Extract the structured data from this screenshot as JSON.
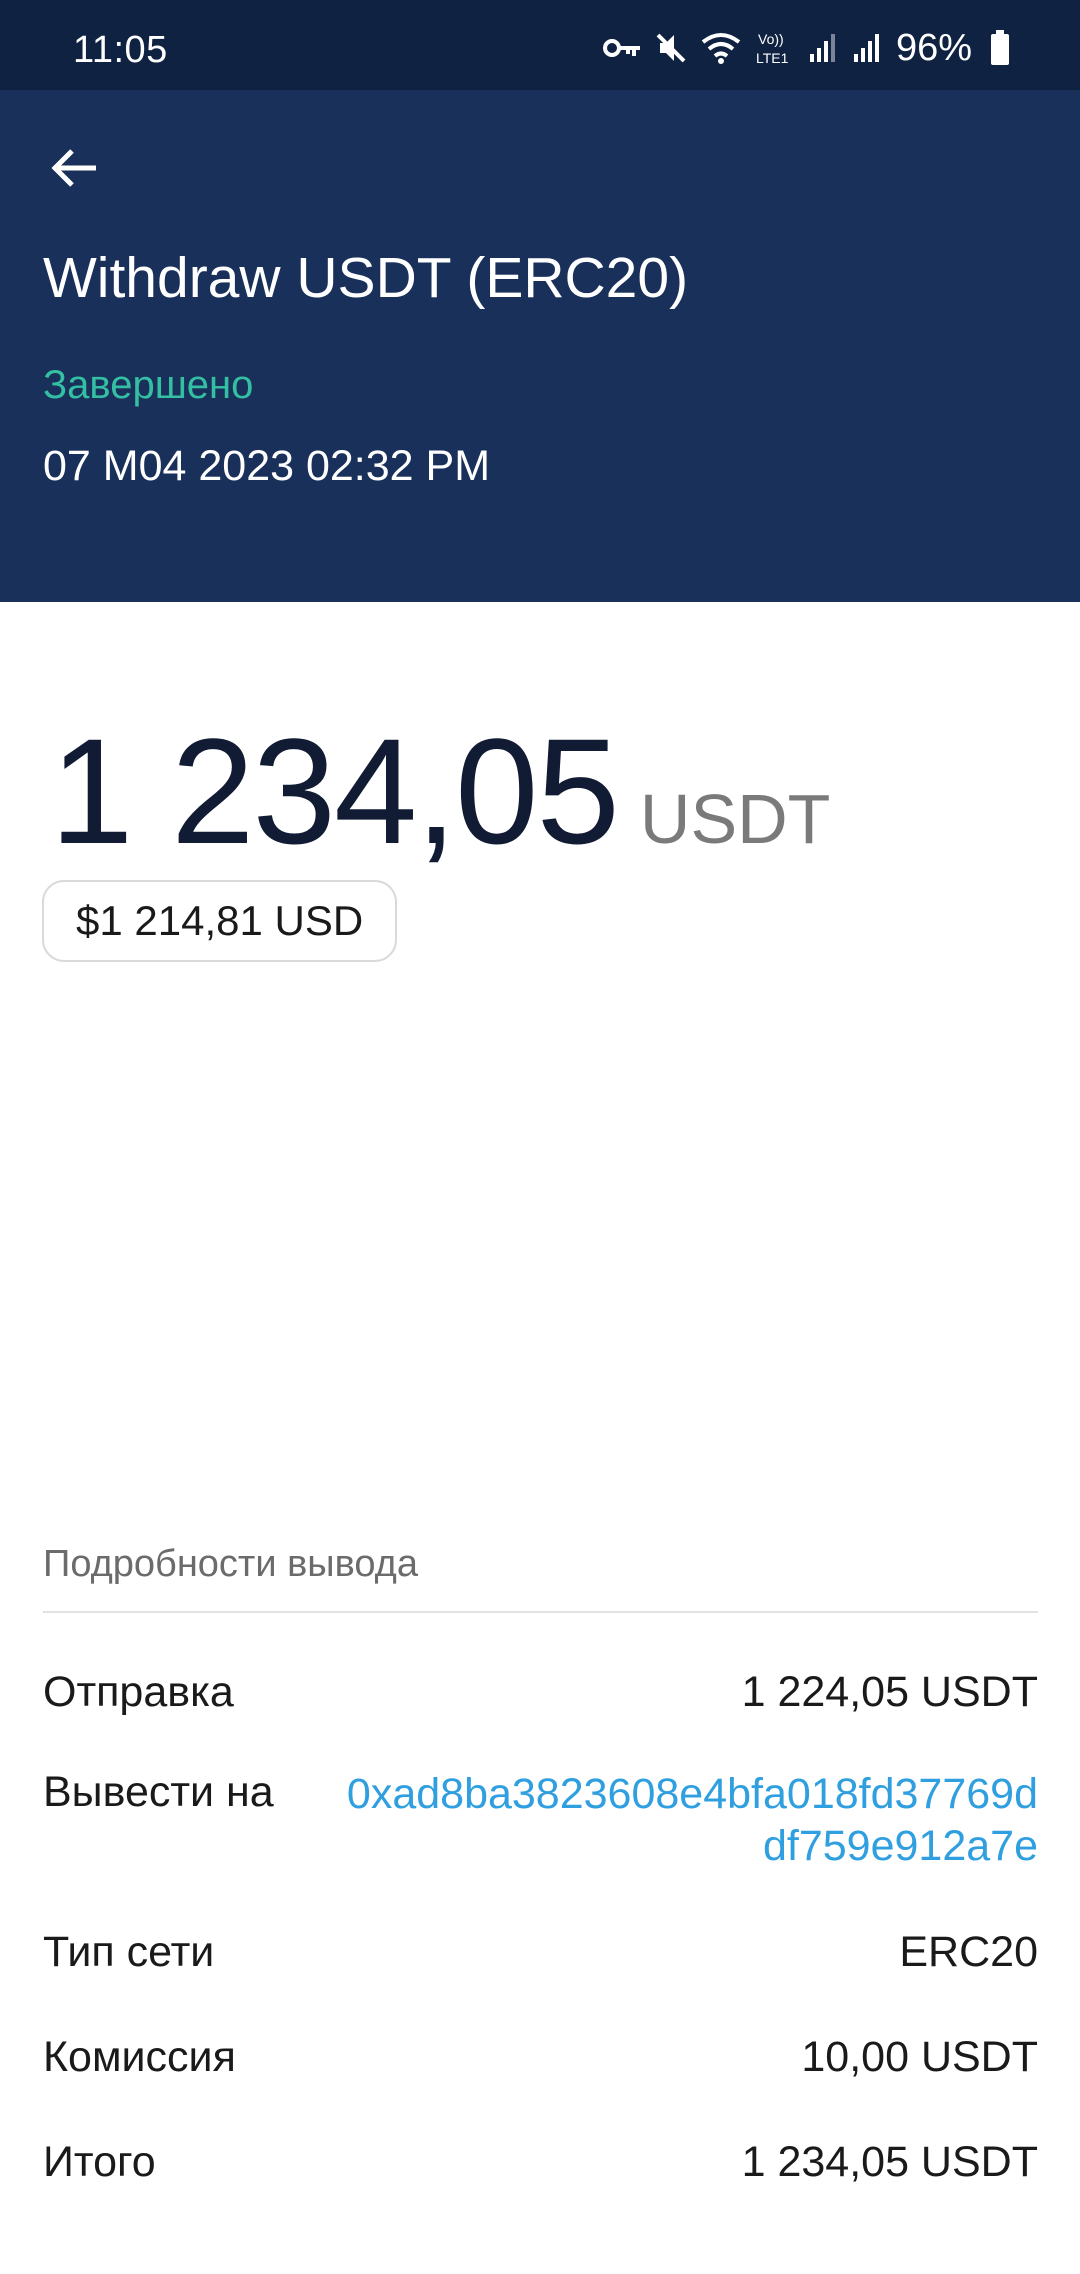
{
  "status_bar": {
    "time": "11:05",
    "battery": "96%",
    "icons": [
      "vpn-key-icon",
      "mute-icon",
      "wifi-icon",
      "volte-icon",
      "signal-icon",
      "signal-icon",
      "battery-icon"
    ],
    "volte_label": "Vo)) LTE1"
  },
  "header": {
    "back_icon": "arrow-left-icon",
    "title": "Withdraw USDT (ERC20)",
    "status": "Завершено",
    "datetime": "07 M04 2023 02:32 PM",
    "background": "#19305a",
    "status_color": "#34bfa3"
  },
  "amount": {
    "value": "1 234,05",
    "unit": "USDT",
    "fiat": "$1 214,81 USD"
  },
  "details": {
    "title": "Подробности вывода",
    "rows": [
      {
        "label": "Отправка",
        "value": "1 224,05 USDT"
      },
      {
        "label": "Вывести на",
        "value": "0xad8ba3823608e4bfa018fd37769ddf759e912a7e"
      },
      {
        "label": "Тип сети",
        "value": "ERC20"
      },
      {
        "label": "Комиссия",
        "value": "10,00 USDT"
      },
      {
        "label": "Итого",
        "value": "1 234,05 USDT"
      }
    ],
    "link_color": "#2f9fe0"
  }
}
